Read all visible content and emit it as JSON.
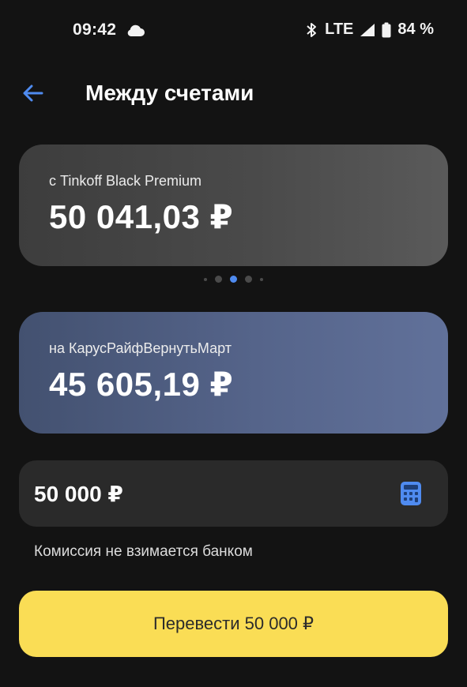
{
  "status_bar": {
    "time": "09:42",
    "network": "LTE",
    "battery": "84 %",
    "icons": [
      "cloud-icon",
      "bluetooth-icon",
      "signal-icon",
      "battery-icon"
    ]
  },
  "header": {
    "back_icon": "arrow-left-icon",
    "title": "Между счетами"
  },
  "source_account": {
    "label": "с Tinkoff Black Premium",
    "amount": "50 041,03 ₽"
  },
  "carousel": {
    "count": 5,
    "active_index": 2
  },
  "destination_account": {
    "label": "на КарусРайфВернутьМарт",
    "amount": "45 605,19 ₽"
  },
  "transfer_amount": {
    "value": "50 000 ₽",
    "icon": "calculator-icon"
  },
  "commission_text": "Комиссия не взимается банком",
  "submit": {
    "label": "Перевести 50 000 ₽"
  },
  "colors": {
    "background": "#131313",
    "accent": "#4f8bf0",
    "button": "#fadd55",
    "destination_card": "#55648a",
    "source_card": "#4a4a4a"
  }
}
